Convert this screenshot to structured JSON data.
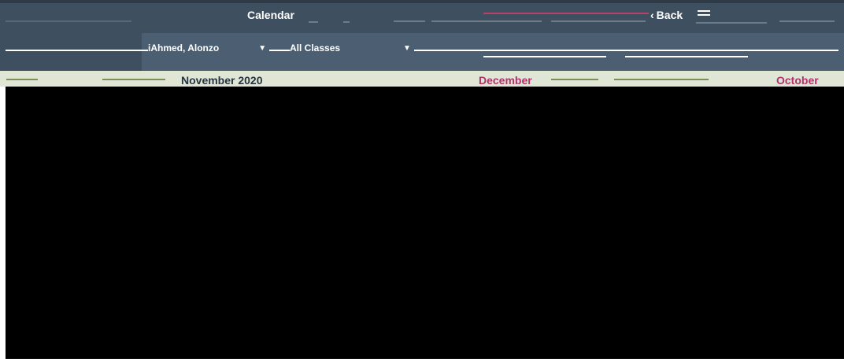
{
  "header": {
    "title": "Calendar",
    "back_label": "Back"
  },
  "filters": {
    "student": "iAhmed, Alonzo",
    "classes": "All Classes"
  },
  "months": {
    "current": "November 2020",
    "previous": "December",
    "next": "October"
  },
  "colors": {
    "header_bg": "#3e4f60",
    "filter_bg": "#4c5f72",
    "accent": "#b3306a",
    "band_bg": "#dfe6d5",
    "content_bg": "#000000"
  }
}
